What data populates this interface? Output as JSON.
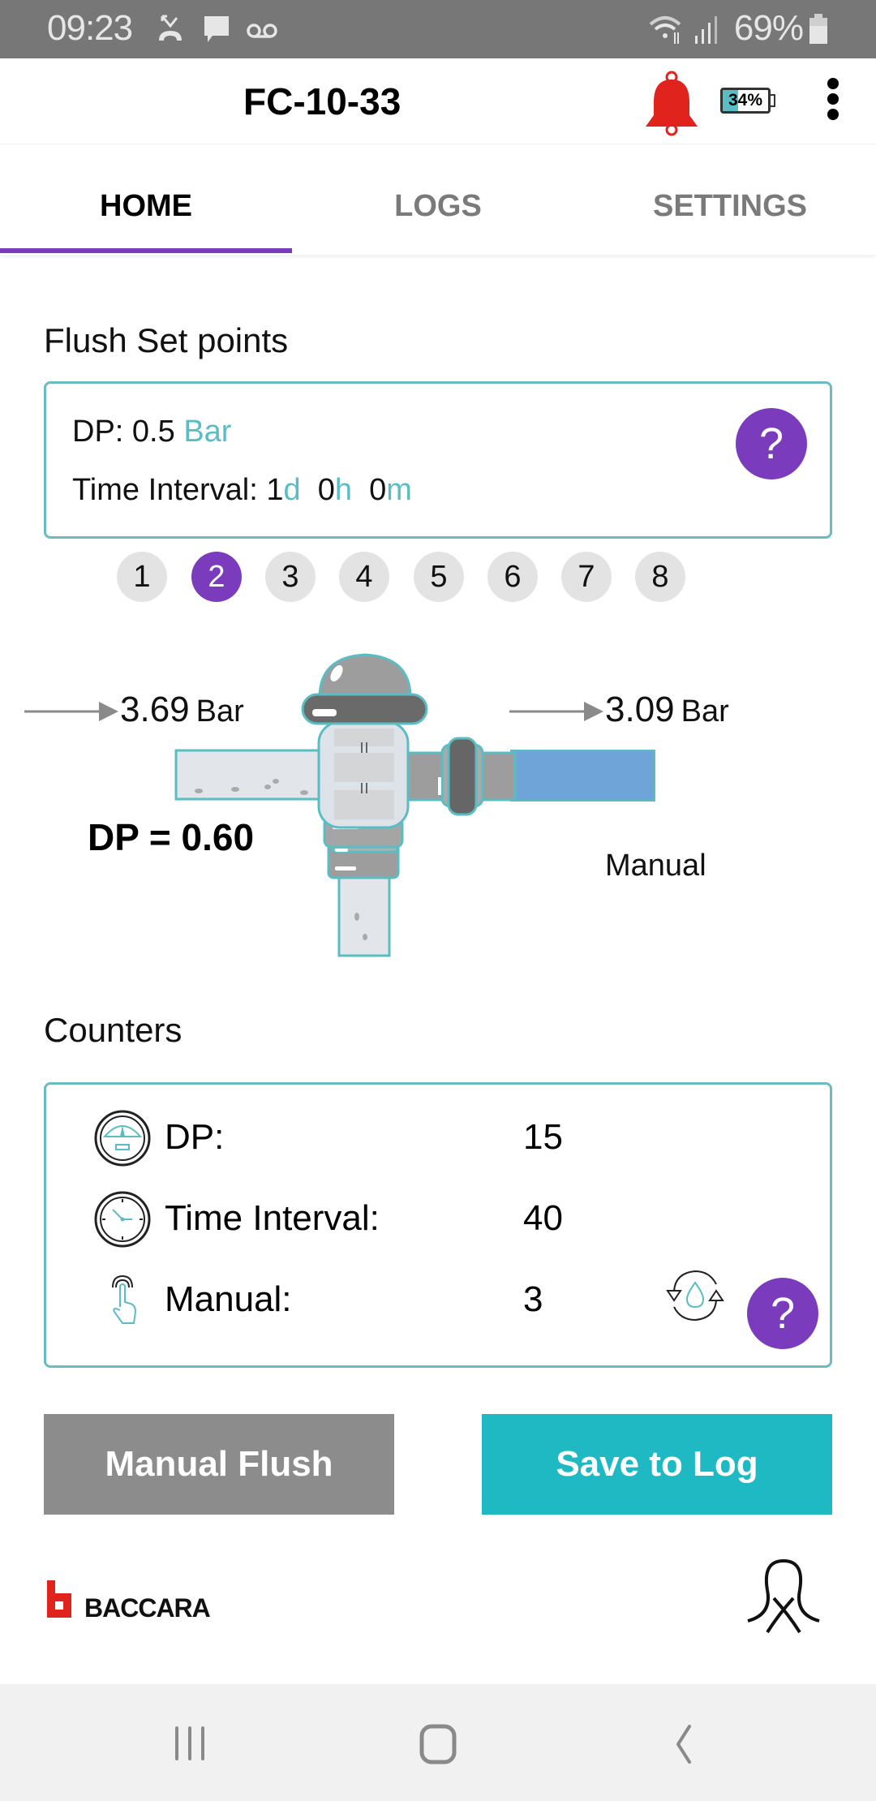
{
  "status_bar": {
    "time": "09:23",
    "notification_icons": [
      "missed-call-icon",
      "message-icon",
      "voicemail-icon"
    ],
    "system_icons": [
      "wifi-icon",
      "signal-icon",
      "battery-icon"
    ],
    "battery_percent": "69%"
  },
  "app_bar": {
    "title": "FC-10-33",
    "alarm_color": "#e0231c",
    "device_battery_label": "34%",
    "device_battery_level": 0.34,
    "menu_icon": "more-vertical-icon"
  },
  "tabs": [
    {
      "label": "HOME",
      "active": true
    },
    {
      "label": "LOGS",
      "active": false
    },
    {
      "label": "SETTINGS",
      "active": false
    }
  ],
  "setpoints": {
    "title": "Flush Set points",
    "dp_label": "DP:",
    "dp_value": "0.5",
    "dp_unit": "Bar",
    "interval_label": "Time Interval:",
    "interval_days": "1",
    "interval_days_unit": "d",
    "interval_hours": "0",
    "interval_hours_unit": "h",
    "interval_minutes": "0",
    "interval_minutes_unit": "m",
    "help_label": "?"
  },
  "stations": {
    "items": [
      "1",
      "2",
      "3",
      "4",
      "5",
      "6",
      "7",
      "8"
    ],
    "selected": "2"
  },
  "illustration": {
    "inlet_pressure": "3.69",
    "inlet_unit": "Bar",
    "outlet_pressure": "3.09",
    "outlet_unit": "Bar",
    "dp_readout": "DP = 0.60",
    "mode": "Manual"
  },
  "counters": {
    "title": "Counters",
    "rows": [
      {
        "icon": "pressure-gauge-icon",
        "label": "DP:",
        "value": "15"
      },
      {
        "icon": "clock-icon",
        "label": "Time Interval:",
        "value": "40"
      },
      {
        "icon": "touch-hand-icon",
        "label": "Manual:",
        "value": "3"
      }
    ],
    "reset_icon": "water-cycle-icon",
    "help_label": "?"
  },
  "actions": {
    "manual_flush": "Manual Flush",
    "save_to_log": "Save to Log"
  },
  "footer": {
    "brand": "BACCARA"
  },
  "colors": {
    "accent_purple": "#7b3bbd",
    "accent_teal": "#1fb9c4",
    "card_border": "#6bbcc0",
    "button_gray": "#8c8c8c"
  }
}
